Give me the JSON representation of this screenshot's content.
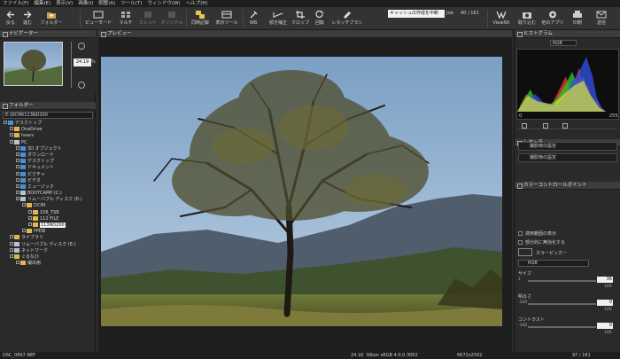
{
  "menubar": [
    "ファイル(F)",
    "編集(E)",
    "表示(V)",
    "画像(I)",
    "調整(A)",
    "ツール(T)",
    "ウィンドウ(W)",
    "ヘルプ(H)"
  ],
  "toolbar": {
    "back": "戻る",
    "forward": "進む",
    "folder": "フォルダー",
    "viewer_mode": "ビューモード",
    "multi": "マルチ",
    "current": "カレント",
    "original": "オリジナル",
    "sync_record": "同時記録",
    "display_tool": "表示ツール",
    "wb": "WB",
    "tone": "傾き補正",
    "crop": "クロップ",
    "rotate": "回転",
    "retouch": "レタッチブラシ",
    "status_caption": "キャッシュの作成を中断",
    "job": "Job",
    "counter": "40 /  161",
    "viewnx": "ViewNX",
    "import": "取り込む",
    "other_apps": "他のアプリ",
    "print": "印刷",
    "send": "送信"
  },
  "navigator": {
    "title": "ナビゲーター",
    "zoom": "24.19",
    "zoom_unit": "%"
  },
  "folders": {
    "title": "フォルダー",
    "path": "E:\\DCIM\\113ND200",
    "tree": [
      {
        "label": "デスクトップ",
        "indent": 0,
        "icon": "blue"
      },
      {
        "label": "OneDrive",
        "indent": 1,
        "icon": "folder"
      },
      {
        "label": "hears",
        "indent": 1,
        "icon": "folder"
      },
      {
        "label": "PC",
        "indent": 1,
        "icon": "drive"
      },
      {
        "label": "3D オブジェクト",
        "indent": 2,
        "icon": "blue"
      },
      {
        "label": "ダウンロード",
        "indent": 2,
        "icon": "blue"
      },
      {
        "label": "デスクトップ",
        "indent": 2,
        "icon": "blue"
      },
      {
        "label": "ドキュメント",
        "indent": 2,
        "icon": "blue"
      },
      {
        "label": "ピクチャ",
        "indent": 2,
        "icon": "blue"
      },
      {
        "label": "ビデオ",
        "indent": 2,
        "icon": "blue"
      },
      {
        "label": "ミュージック",
        "indent": 2,
        "icon": "blue"
      },
      {
        "label": "BOOTCAMP (C:)",
        "indent": 2,
        "icon": "drive"
      },
      {
        "label": "リムーバブル ディスク (E:)",
        "indent": 2,
        "icon": "drive"
      },
      {
        "label": "DCIM",
        "indent": 3,
        "icon": "folder"
      },
      {
        "label": "106_TSB",
        "indent": 4,
        "icon": "folder"
      },
      {
        "label": "112 FILE",
        "indent": 4,
        "icon": "folder"
      },
      {
        "label": "113ND200",
        "indent": 4,
        "icon": "folder",
        "selected": true
      },
      {
        "label": "FPDB",
        "indent": 3,
        "icon": "folder"
      },
      {
        "label": "ライブラリ",
        "indent": 1,
        "icon": "folder"
      },
      {
        "label": "リムーバブル ディスク (E:)",
        "indent": 1,
        "icon": "drive"
      },
      {
        "label": "ネットワーク",
        "indent": 1,
        "icon": "drive"
      },
      {
        "label": "ぐるなび",
        "indent": 1,
        "icon": "folder"
      },
      {
        "label": "撮出用",
        "indent": 2,
        "icon": "folder"
      }
    ]
  },
  "preview": {
    "title": "プレビュー"
  },
  "histogram": {
    "title": "ヒストグラム",
    "channel": "RGB",
    "min": "0",
    "max": "255"
  },
  "retouch": {
    "title": "レタッチ",
    "row1": "撮影時の設定",
    "row2": "撮影時の設定"
  },
  "color_control": {
    "title": "カラーコントロールポイント",
    "show_range": "適用範囲の表示",
    "disable_some": "部分的に無効化する",
    "color_picker": "カラーピッカー",
    "mode": "RGB",
    "sliders": [
      {
        "label": "サイズ",
        "min": "1",
        "value": "36",
        "max": "100"
      },
      {
        "label": "明るさ",
        "min": "-100",
        "value": "0",
        "max": "100"
      },
      {
        "label": "コントラスト",
        "min": "-100",
        "value": "0",
        "max": "100"
      }
    ]
  },
  "status": {
    "filename": "DSC_0897.NEF",
    "size": "24.1K",
    "profile": "Nikon sRGB 4.0.0.3002",
    "dimensions": "6672x2502",
    "page": "97 / 161"
  },
  "colors": {
    "accent": "#e1b64b",
    "panel": "#2a2a2a",
    "header": "#3c3c3c"
  }
}
